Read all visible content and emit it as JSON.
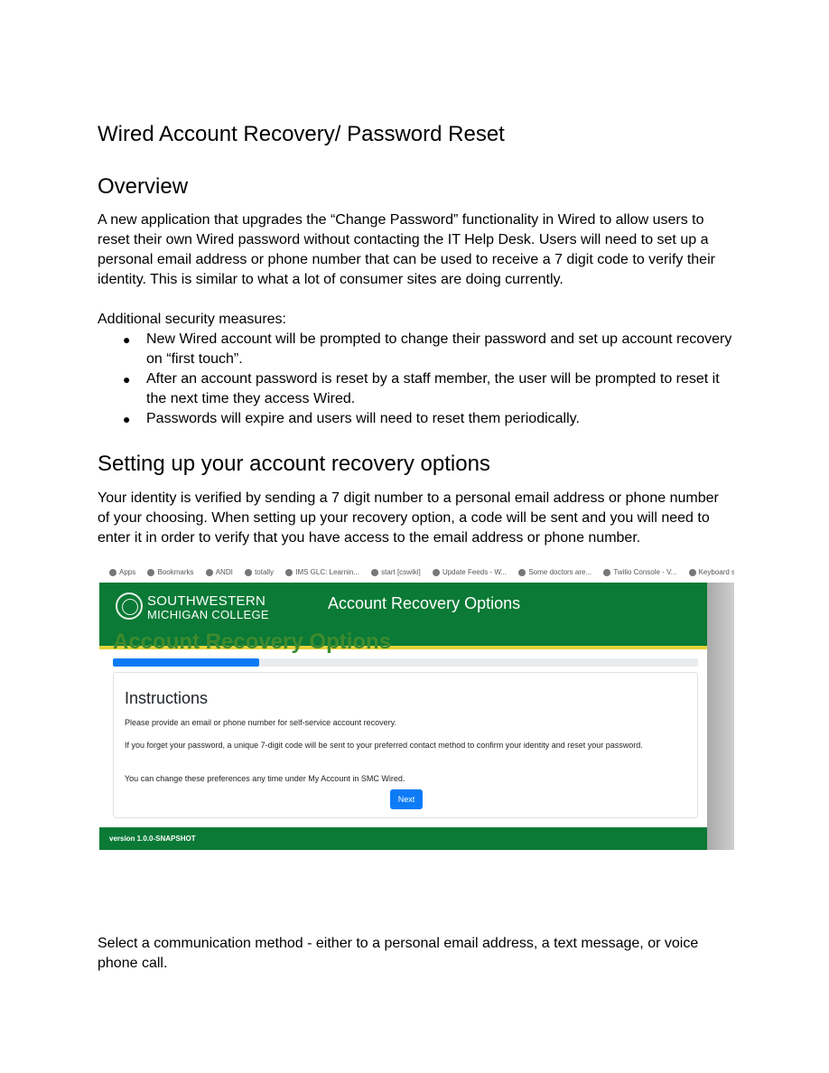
{
  "document": {
    "title": "Wired Account Recovery/ Password Reset",
    "overview_heading": "Overview",
    "overview_text": "A new application that upgrades the “Change Password” functionality in Wired to allow users to reset their own Wired password without contacting the IT Help Desk. Users will need to set up a personal email address or phone number that can be used to receive a 7 digit code to verify their identity. This is similar to what a lot of consumer sites are doing currently.",
    "security_intro": "Additional security measures:",
    "bullet_symbol": "●",
    "bullets": [
      "New Wired account will be prompted to change their password and set up account recovery on “first touch”.",
      "After an account password is reset by a staff member, the user will be prompted to reset it the next time they access Wired.",
      "Passwords will expire and users will need to reset them periodically."
    ],
    "setup_heading": "Setting up your account recovery options",
    "setup_text": "Your identity is verified by sending a 7 digit number to a personal email address or phone number of your choosing. When setting up your recovery option, a code will be sent and you will need to enter it in order to verify that you have access to the email address or phone number.",
    "select_text": "Select a communication method - either to a personal email address, a text message, or voice phone call."
  },
  "screenshot": {
    "bookmarks": [
      "Apps",
      "Bookmarks",
      "ANDI",
      "totally",
      "IMS GLC: Learnin...",
      "start [cswiki]",
      "Update Feeds - W...",
      "Some doctors are...",
      "Twilio Console - V...",
      "Keyboard sh"
    ],
    "logo_line1": "SOUTHWESTERN",
    "logo_line2": "MICHIGAN COLLEGE",
    "header_title": "Account Recovery Options",
    "page_heading": "Account Recovery Options",
    "progress_percent": 25,
    "card_heading": "Instructions",
    "instruction_1": "Please provide an email or phone number for self-service account recovery.",
    "instruction_2": "If you forget your password, a unique 7-digit code will be sent to your preferred contact method to confirm your identity and reset your password.",
    "instruction_3": "You can change these preferences any time under My Account in SMC Wired.",
    "next_label": "Next",
    "version": "version 1.0.0-SNAPSHOT",
    "colors": {
      "brand_green": "#0a7a36",
      "accent_yellow": "#e6d23a",
      "heading_green": "#3f8a2e",
      "primary_blue": "#0d7bf5"
    }
  }
}
